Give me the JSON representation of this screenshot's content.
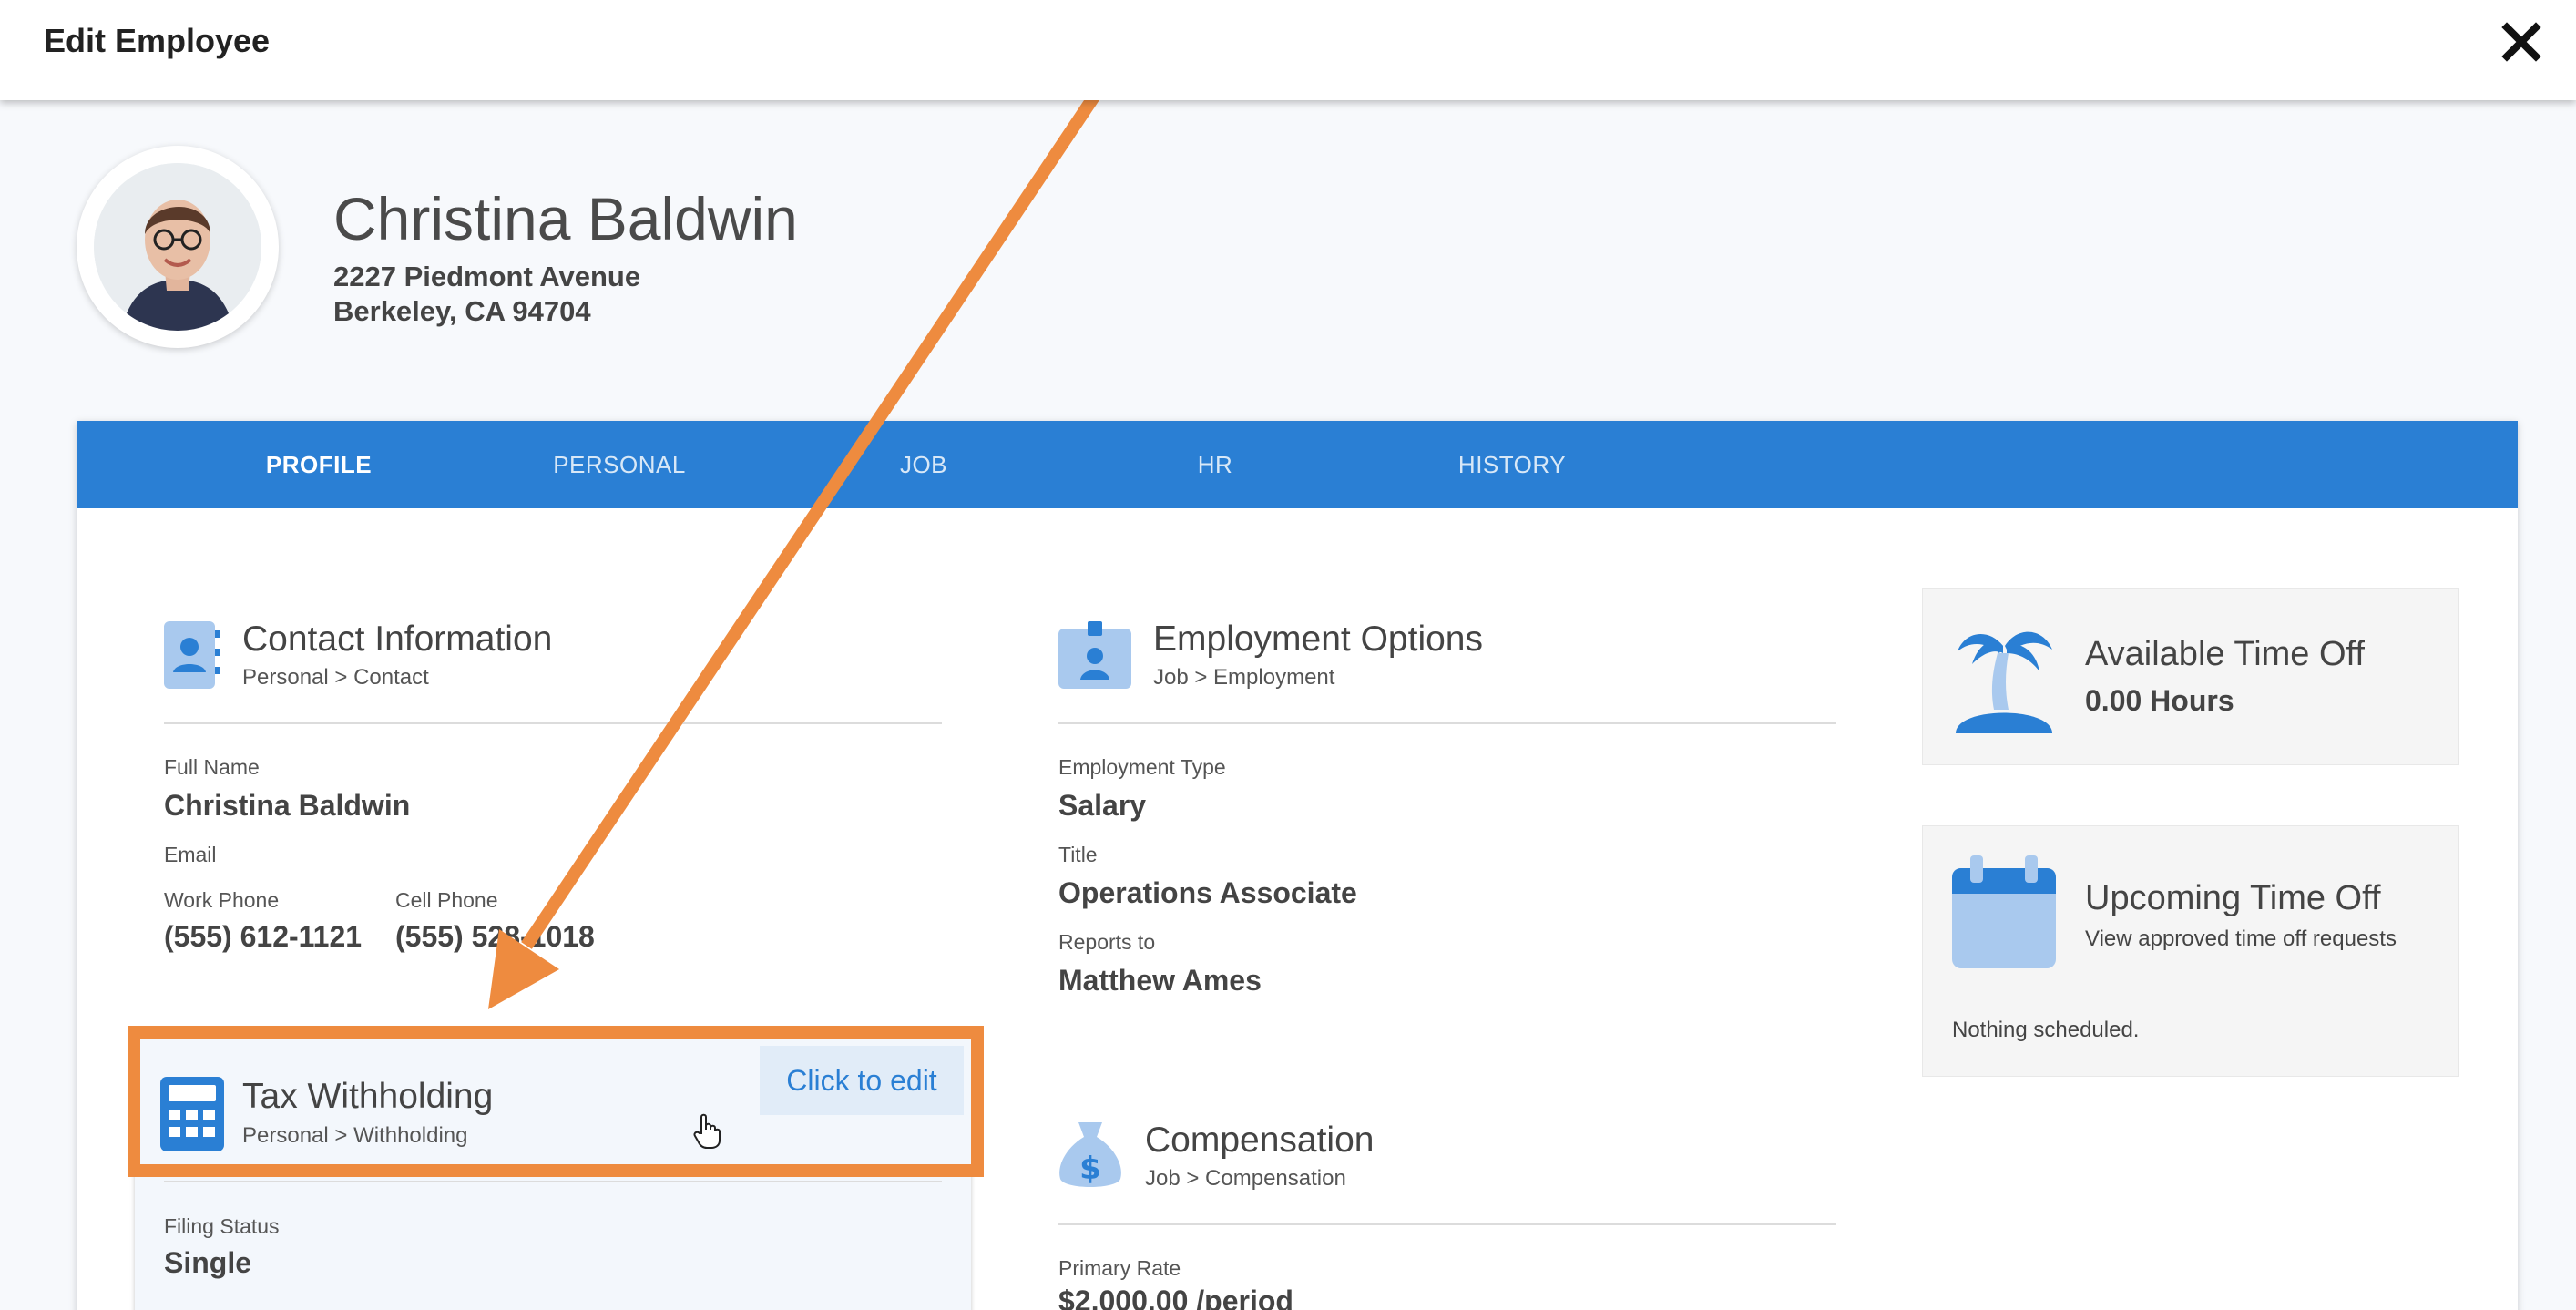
{
  "header": {
    "title": "Edit Employee"
  },
  "employee": {
    "name": "Christina Baldwin",
    "address_line1": "2227 Piedmont Avenue",
    "address_line2": "Berkeley, CA 94704"
  },
  "tabs": [
    {
      "label": "PROFILE",
      "active": true
    },
    {
      "label": "PERSONAL"
    },
    {
      "label": "JOB"
    },
    {
      "label": "HR"
    },
    {
      "label": "HISTORY"
    }
  ],
  "contact": {
    "title": "Contact Information",
    "breadcrumb": "Personal > Contact",
    "full_name_label": "Full Name",
    "full_name": "Christina Baldwin",
    "email_label": "Email",
    "work_phone_label": "Work Phone",
    "work_phone": "(555) 612-1121",
    "cell_phone_label": "Cell Phone",
    "cell_phone": "(555) 528-1018"
  },
  "tax": {
    "title": "Tax Withholding",
    "breadcrumb": "Personal > Withholding",
    "edit_label": "Click to edit",
    "filing_status_label": "Filing Status",
    "filing_status": "Single"
  },
  "employment": {
    "title": "Employment Options",
    "breadcrumb": "Job > Employment",
    "type_label": "Employment Type",
    "type": "Salary",
    "title_label": "Title",
    "job_title": "Operations Associate",
    "reports_to_label": "Reports to",
    "reports_to": "Matthew Ames"
  },
  "compensation": {
    "title": "Compensation",
    "breadcrumb": "Job > Compensation",
    "primary_rate_label": "Primary Rate",
    "primary_rate": "$2,000.00 /period"
  },
  "time_off": {
    "title": "Available Time Off",
    "hours": "0.00 Hours"
  },
  "upcoming": {
    "title": "Upcoming Time Off",
    "subtitle": "View approved time off requests",
    "empty": "Nothing scheduled."
  },
  "colors": {
    "accent": "#2a7fd4",
    "highlight": "#ee8b3f",
    "icon_light": "#a9c9ee"
  }
}
